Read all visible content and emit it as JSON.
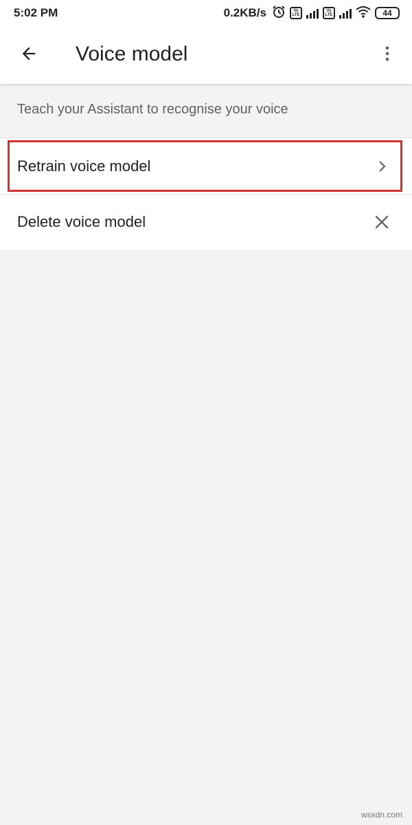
{
  "status_bar": {
    "time": "5:02 PM",
    "net_speed": "0.2KB/s",
    "volte_1": "Vo LTE",
    "volte_2": "Vo LTE",
    "battery_level": "44",
    "icons": [
      "alarm-icon",
      "volte-icon",
      "signal-icon",
      "volte-icon",
      "signal-icon",
      "wifi-icon",
      "battery-icon"
    ]
  },
  "app_bar": {
    "title": "Voice model",
    "back_icon": "arrow-back-icon",
    "menu_icon": "more-vert-icon"
  },
  "content": {
    "subtitle": "Teach your Assistant to recognise your voice",
    "items": [
      {
        "label": "Retrain voice model",
        "icon": "chevron-right-icon",
        "highlighted": true
      },
      {
        "label": "Delete voice model",
        "icon": "close-icon",
        "highlighted": false
      }
    ]
  },
  "watermark": "wsxdn.com",
  "colors": {
    "highlight": "#d32f2f",
    "background": "#f3f3f3",
    "surface": "#ffffff",
    "text_primary": "#202124",
    "text_secondary": "#5f6368"
  }
}
